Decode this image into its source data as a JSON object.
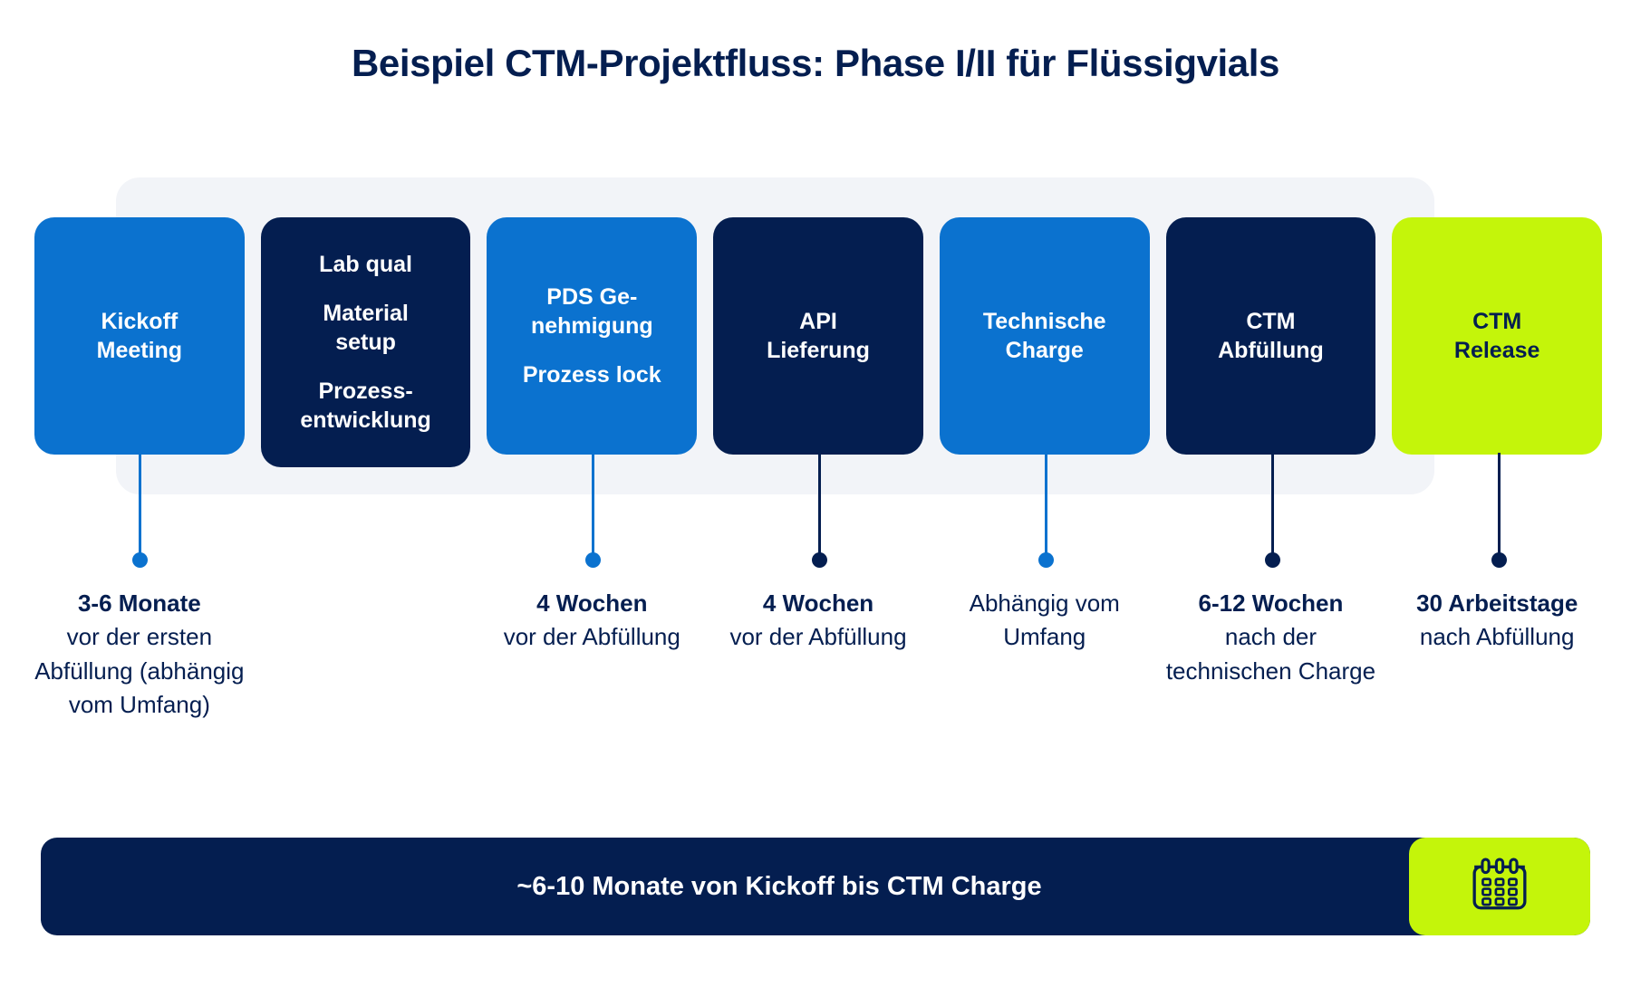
{
  "header": {
    "title": "Beispiel CTM-Projektfluss: Phase I/II für Flüssigvials"
  },
  "colors": {
    "navy": "#041e50",
    "blue": "#0b72cf",
    "lime": "#c4f50a",
    "panel": "#f2f4f8",
    "background": "#ffffff"
  },
  "stages": [
    {
      "id": "kickoff-meeting",
      "color": "blue",
      "lines": [
        [
          "Kickoff",
          "Meeting"
        ]
      ],
      "connector": "blue"
    },
    {
      "id": "lab-qual-material-setup",
      "color": "navy",
      "lines": [
        [
          "Lab qual"
        ],
        [
          "Material",
          "setup"
        ],
        [
          "Prozess-",
          "entwicklung"
        ]
      ],
      "connector": "none"
    },
    {
      "id": "pds-genehmigung",
      "color": "blue",
      "lines": [
        [
          "PDS Ge-",
          "nehmigung"
        ],
        [
          "Prozess lock"
        ]
      ],
      "connector": "blue"
    },
    {
      "id": "api-lieferung",
      "color": "navy",
      "lines": [
        [
          "API",
          "Lieferung"
        ]
      ],
      "connector": "navy"
    },
    {
      "id": "technische-charge",
      "color": "blue",
      "lines": [
        [
          "Technische",
          "Charge"
        ]
      ],
      "connector": "blue"
    },
    {
      "id": "ctm-abfuellung",
      "color": "navy",
      "lines": [
        [
          "CTM",
          "Abfüllung"
        ]
      ],
      "connector": "navy"
    },
    {
      "id": "ctm-release",
      "color": "lime",
      "lines": [
        [
          "CTM",
          "Release"
        ]
      ],
      "connector": "navy"
    }
  ],
  "captions": [
    {
      "id": "kickoff-timing",
      "lead": "3-6 Monate",
      "rest": "vor der ersten Abfüllung (abhängig vom Umfang)"
    },
    {
      "id": "lab-qual-timing",
      "lead": "",
      "rest": ""
    },
    {
      "id": "pds-timing",
      "lead": "4 Wochen",
      "rest": "vor der Abfüllung"
    },
    {
      "id": "api-timing",
      "lead": "4 Wochen",
      "rest": "vor der Abfüllung"
    },
    {
      "id": "technische-charge-timing",
      "lead": "",
      "rest": "Abhängig vom Umfang"
    },
    {
      "id": "ctm-abfuellung-timing",
      "lead": "6-12 Wochen",
      "rest": "nach der technischen Charge"
    },
    {
      "id": "ctm-release-timing",
      "lead": "30 Arbeitstage",
      "rest": "nach Abfüllung"
    }
  ],
  "footer": {
    "summary": "~6-10 Monate von Kickoff bis CTM Charge",
    "icon": "calendar-icon"
  }
}
